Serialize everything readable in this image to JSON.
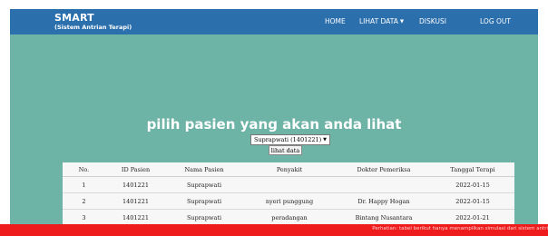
{
  "brand": {
    "title": "SMART",
    "subtitle": "(Sistem Antrian Terapi)"
  },
  "nav": {
    "home": "HOME",
    "lihat_data": "LIHAT DATA",
    "diskusi": "DISKUSI",
    "logout": "LOG OUT"
  },
  "main": {
    "heading": "pilih pasien yang akan anda lihat",
    "select_value": "Suprapwati (1401221)",
    "submit_label": "lihat data"
  },
  "table": {
    "headers": {
      "no": "No.",
      "id": "ID Pasien",
      "nama": "Nama Pasien",
      "penyakit": "Penyakit",
      "dokter": "Dokter Pemeriksa",
      "tanggal": "Tanggal Terapi"
    },
    "rows": [
      {
        "no": "1",
        "id": "1401221",
        "nama": "Suprapwati",
        "penyakit": "",
        "dokter": "",
        "tanggal": "2022-01-15"
      },
      {
        "no": "2",
        "id": "1401221",
        "nama": "Suprapwati",
        "penyakit": "nyeri punggung",
        "dokter": "Dr. Happy Hogan",
        "tanggal": "2022-01-15"
      },
      {
        "no": "3",
        "id": "1401221",
        "nama": "Suprapwati",
        "penyakit": "peradangan",
        "dokter": "Bintang Nusantara",
        "tanggal": "2022-01-21"
      }
    ]
  },
  "footer": {
    "text": "Perhatian: tabel berikut hanya menampilkan simulasi dari sistem antri"
  },
  "colors": {
    "navbar": "#2b6fad",
    "background": "#6db3a6",
    "footer": "#ee1c1c"
  }
}
